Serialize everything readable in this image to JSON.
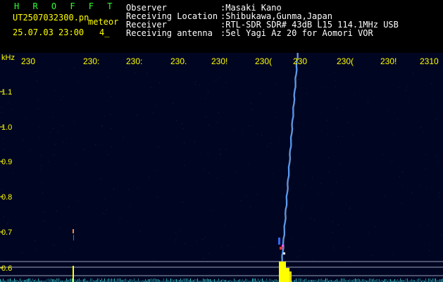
{
  "header": {
    "app_title": "H R O F F T",
    "filename": "UT2507032300.pn",
    "event_tag": "meteor",
    "datetime": "25.07.03 23:00",
    "count": "4_"
  },
  "station": {
    "observer_label": "Observer",
    "observer_value": ":Masaki Kano",
    "location_label": "Receiving Location",
    "location_value": ":Shibukawa,Gunma,Japan",
    "receiver_label": "Receiver",
    "receiver_value": ":RTL-SDR SDR# 43dB L15 114.1MHz USB",
    "antenna_label": "Receiving antenna",
    "antenna_value": ":5el Yagi Az 20 for Aomori VOR"
  },
  "plot": {
    "y_unit": "kHz",
    "y_ticks": [
      "1.1",
      "1.0",
      "0.9",
      "0.8",
      "0.7",
      "0.6"
    ],
    "time_ticks": [
      "230",
      "230:",
      "230:",
      "230.",
      "230!",
      "230(",
      "230",
      "230(",
      "230!",
      "2310"
    ],
    "colors": {
      "background": "#000622",
      "axis_text": "#ffff00",
      "header_green": "#33ff33",
      "meteor_trace": "#5aa0ff",
      "noise_floor": "#40ffff"
    }
  }
}
